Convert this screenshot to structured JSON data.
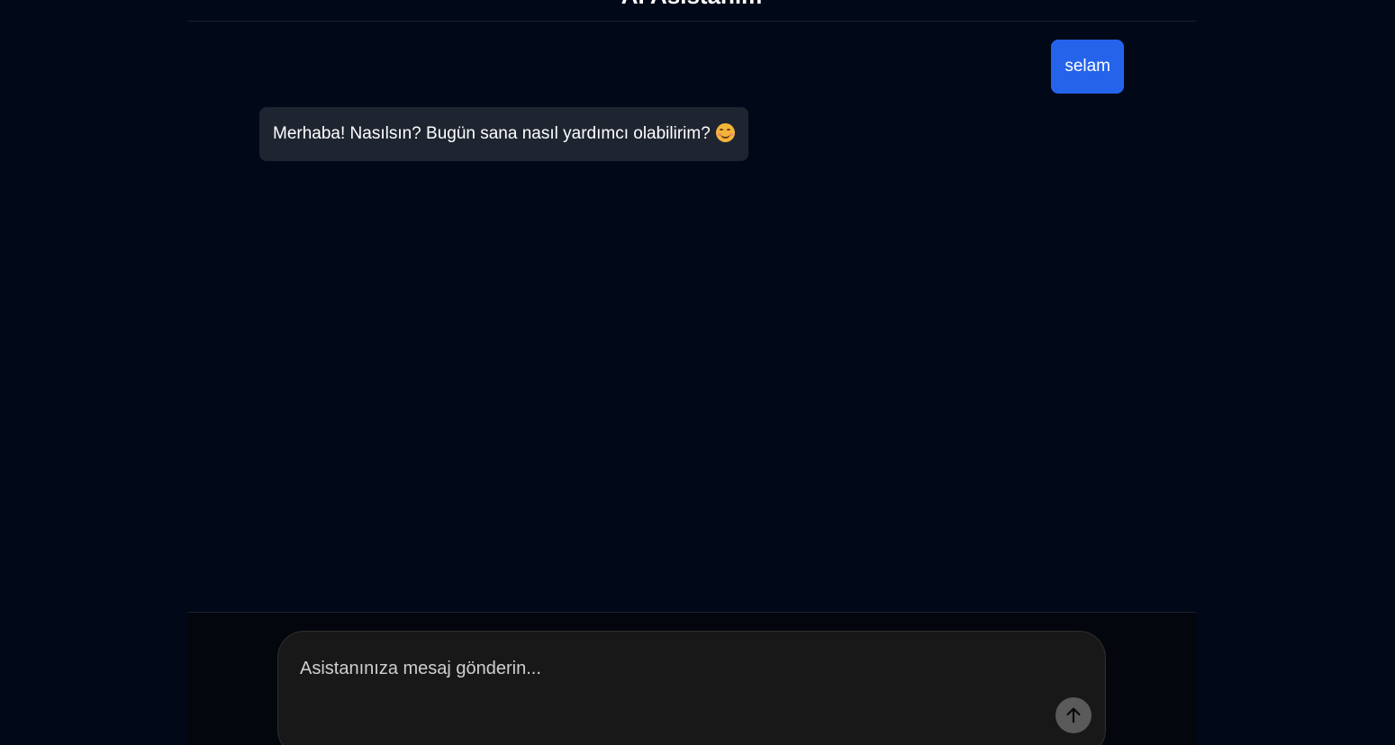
{
  "header": {
    "title": "AI Asistanım"
  },
  "messages": [
    {
      "role": "user",
      "text": "selam"
    },
    {
      "role": "assistant",
      "text": "Merhaba!  Nasılsın?  Bugün sana nasıl yardımcı olabilirim?",
      "emoji_icon": "smiling-face-icon"
    }
  ],
  "composer": {
    "placeholder": "Asistanınıza mesaj gönderin...",
    "value": "",
    "send_icon": "arrow-up-icon"
  },
  "colors": {
    "background": "#010817",
    "user_bubble": "#2563eb",
    "assistant_bubble": "#1e2531",
    "composer_bg": "#181818",
    "send_button": "#5a5a5a"
  }
}
